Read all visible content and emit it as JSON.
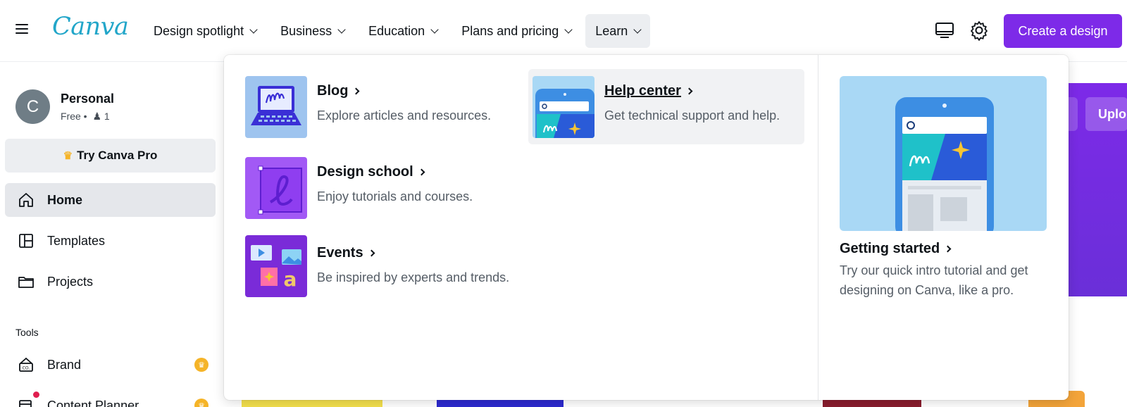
{
  "topbar": {
    "logo": "Canva",
    "nav": [
      {
        "label": "Design spotlight"
      },
      {
        "label": "Business"
      },
      {
        "label": "Education"
      },
      {
        "label": "Plans and pricing"
      },
      {
        "label": "Learn",
        "active": true
      }
    ],
    "icons": [
      "desktop-icon",
      "settings-gear-icon"
    ],
    "create_button": "Create a design"
  },
  "account": {
    "avatar_initial": "C",
    "name": "Personal",
    "plan": "Free •",
    "members": "1"
  },
  "sidebar": {
    "try_pro": "Try Canva Pro",
    "items": [
      {
        "label": "Home",
        "icon": "home-icon",
        "active": true
      },
      {
        "label": "Templates",
        "icon": "templates-icon"
      },
      {
        "label": "Projects",
        "icon": "folder-icon"
      }
    ],
    "tools_label": "Tools",
    "tools": [
      {
        "label": "Brand",
        "icon": "brand-kit-icon",
        "pro": true
      },
      {
        "label": "Content Planner",
        "icon": "calendar-icon",
        "pro": true
      }
    ]
  },
  "background": {
    "hero_button": "Uplo"
  },
  "learn_menu": {
    "items": [
      {
        "title": "Blog",
        "description": "Explore articles and resources.",
        "icon": "laptop-illustration"
      },
      {
        "title": "Help center",
        "description": "Get technical support and help.",
        "icon": "phone-search-illustration",
        "hovered": true
      },
      {
        "title": "Design school",
        "description": "Enjoy tutorials and courses.",
        "icon": "design-school-illustration"
      },
      {
        "title": "Events",
        "description": "Be inspired by experts and trends.",
        "icon": "events-illustration"
      }
    ],
    "feature": {
      "title": "Getting started",
      "description": "Try our quick intro tutorial and get designing on Canva, like a pro.",
      "icon": "phone-tutorial-illustration"
    }
  },
  "colors": {
    "brand_purple": "#7d2ae8",
    "logo_teal": "#22a6c9",
    "pro_badge": "#f5b428"
  }
}
